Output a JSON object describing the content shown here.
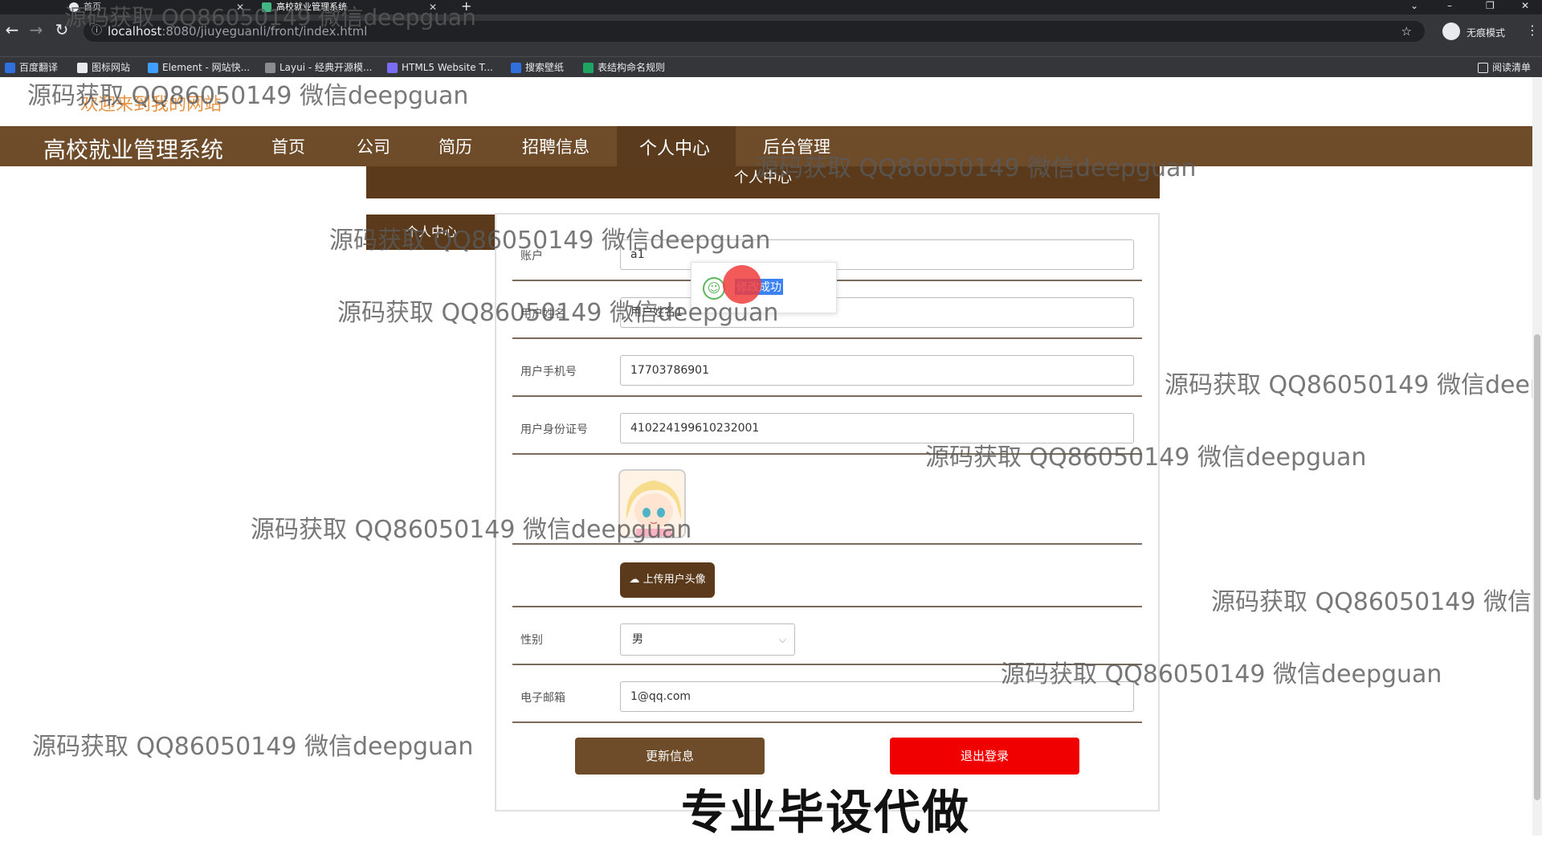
{
  "browser": {
    "tabs": [
      {
        "title": "首页"
      },
      {
        "title": "高校就业管理系统"
      }
    ],
    "new_tab": "+",
    "url_host": "localhost",
    "url_rest": ":8080/jiuyeguanli/front/index.html",
    "profile_label": "无痕模式",
    "reading_list": "阅读清单",
    "bookmarks": [
      "百度翻译",
      "图标网站",
      "Element - 网站快...",
      "Layui - 经典开源模...",
      "HTML5 Website T...",
      "搜索壁纸",
      "表结构命名规则"
    ]
  },
  "page": {
    "welcome": "欢迎来到我的网站",
    "site_title": "高校就业管理系统",
    "nav": [
      "首页",
      "公司",
      "简历",
      "招聘信息",
      "个人中心",
      "后台管理"
    ],
    "center_title": "个人中心",
    "side_tab": "个人中心"
  },
  "form": {
    "account_label": "账户",
    "account_value": "a1",
    "name_label": "用户姓名",
    "name_value": "用户姓名1",
    "phone_label": "用户手机号",
    "phone_value": "17703786901",
    "idcard_label": "用户身份证号",
    "idcard_value": "410224199610232001",
    "upload_label": "上传用户头像",
    "gender_label": "性别",
    "gender_value": "男",
    "email_label": "电子邮箱",
    "email_value": "1@qq.com",
    "update_button": "更新信息",
    "logout_button": "退出登录"
  },
  "toast": {
    "message": "修改成功"
  },
  "overlay": {
    "watermark": "源码获取 QQ86050149 微信deepguan",
    "banner": "专业毕设代做"
  },
  "colors": {
    "nav_brown": "#6e4b29",
    "dark_brown": "#5b3a1b",
    "logout_red": "#f10000",
    "welcome_orange": "#e59344"
  }
}
